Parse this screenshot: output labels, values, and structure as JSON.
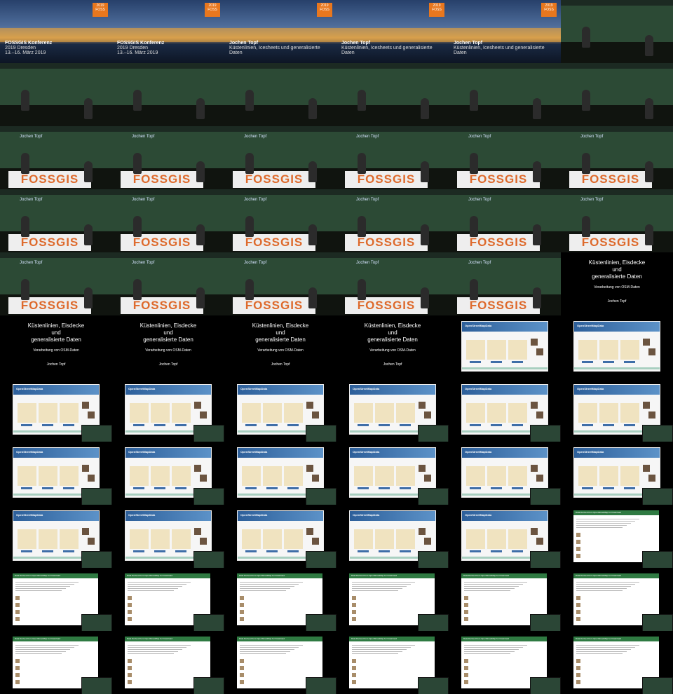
{
  "title_slides": [
    {
      "lines": [
        "FOSSGIS Konferenz",
        "2019 Dresden",
        "13.–16. März 2019"
      ]
    },
    {
      "lines": [
        "FOSSGIS Konferenz",
        "2019 Dresden",
        "13.–16. März 2019"
      ]
    },
    {
      "lines": [
        "Jochen Topf",
        "Küstenlinien, Icesheets und generalisierte",
        "Daten"
      ]
    },
    {
      "lines": [
        "Jochen Topf",
        "Küstenlinien, Icesheets und generalisierte",
        "Daten"
      ]
    },
    {
      "lines": [
        "Jochen Topf",
        "Küstenlinien, Icesheets und generalisierte",
        "Daten"
      ]
    }
  ],
  "badge": {
    "year": "2019",
    "word": "FOSS"
  },
  "hall": {
    "lower_third": "Jochen Topf",
    "banner": "FOSSGIS"
  },
  "talk_slide": {
    "title": "Küstenlinien, Eisdecke\nund\ngeneralisierte Daten",
    "subtitle": "Verarbeitung von OSM-Daten",
    "author": "Jochen Topf"
  },
  "website": {
    "header": "OpenStreetMapData"
  },
  "osm_site": {
    "header": "Data Derived from OpenStreetMap for Download"
  }
}
